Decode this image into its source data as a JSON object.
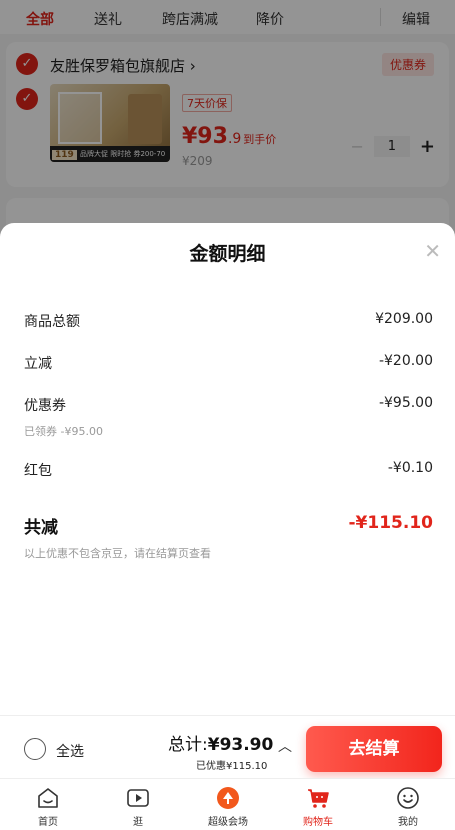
{
  "tabs": [
    {
      "label": "全部",
      "active": true
    },
    {
      "label": "送礼",
      "active": false
    },
    {
      "label": "跨店满减",
      "active": false
    },
    {
      "label": "降价",
      "active": false
    },
    {
      "label": "编辑",
      "active": false
    }
  ],
  "shop": {
    "name": "友胜保罗箱包旗舰店 ›",
    "coupon_label": "优惠券",
    "product": {
      "return_tag": "7天价保",
      "price_int": "¥93",
      "price_dec": ".9",
      "price_note": "到手价",
      "original_price": "¥209",
      "quantity": "1",
      "image_badge": "119",
      "image_strip": "品牌大促 限时抢 券200-70"
    }
  },
  "sheet": {
    "title": "金额明细",
    "close_icon": "close-icon",
    "rows": [
      {
        "label": "商品总额",
        "value": "¥209.00"
      },
      {
        "label": "立减",
        "value": "-¥20.00"
      },
      {
        "label": "优惠券",
        "value": "-¥95.00",
        "sub": "已领券 -¥95.00"
      },
      {
        "label": "红包",
        "value": "-¥0.10"
      }
    ],
    "total_label": "共减",
    "total_value": "-¥115.10",
    "note": "以上优惠不包含京豆，请在结算页查看"
  },
  "checkout": {
    "select_all": "全选",
    "total_prefix": "总计:",
    "total_amount": "¥93.90",
    "saved": "已优惠¥115.10",
    "button": "去结算"
  },
  "nav": [
    {
      "label": "首页",
      "icon": "home-icon"
    },
    {
      "label": "逛",
      "icon": "video-icon"
    },
    {
      "label": "超级会场",
      "icon": "venue-icon"
    },
    {
      "label": "购物车",
      "icon": "cart-icon",
      "active": true
    },
    {
      "label": "我的",
      "icon": "profile-icon"
    }
  ],
  "colors": {
    "accent": "#e1251b",
    "overlay": "rgba(0,0,0,0.42)"
  }
}
